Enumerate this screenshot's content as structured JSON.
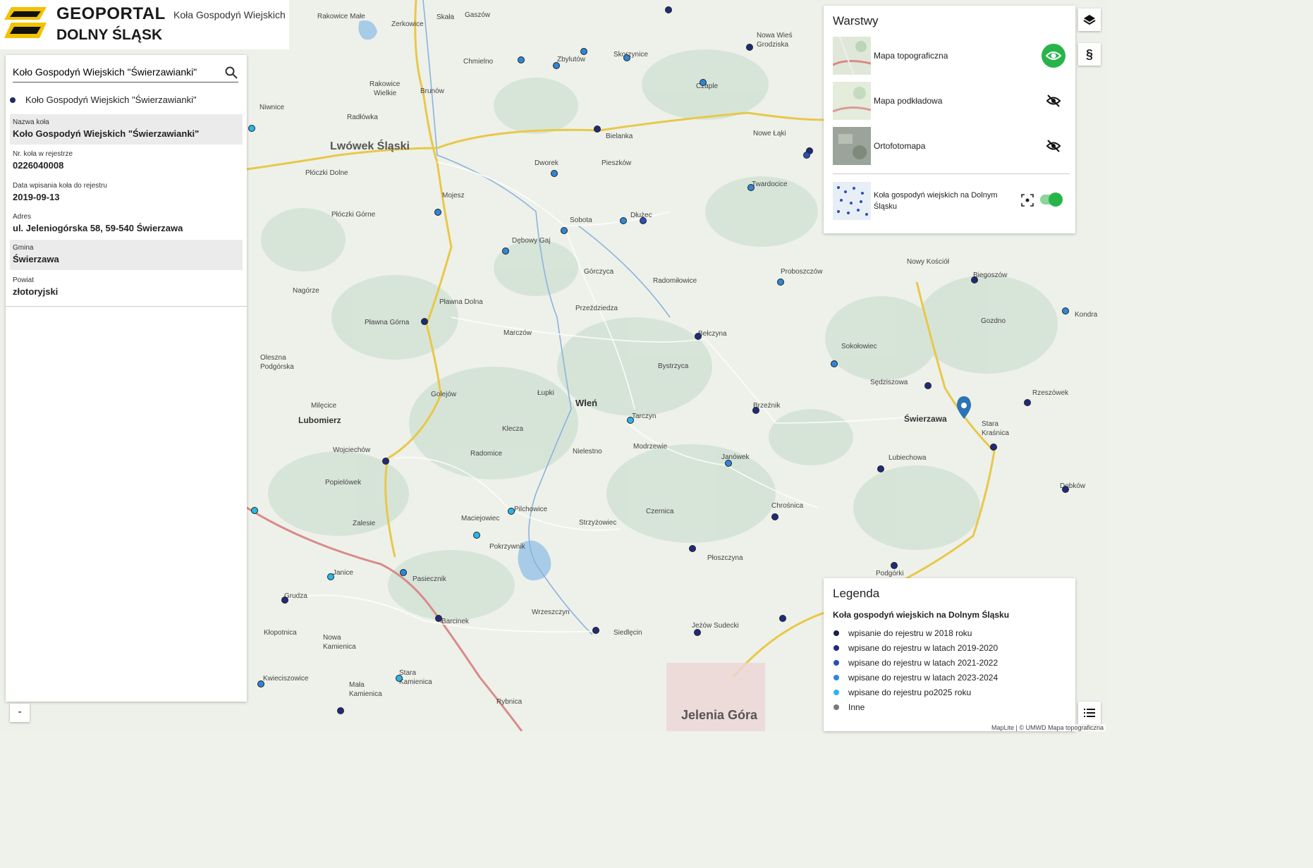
{
  "header": {
    "title_line1": "GEOPORTAL",
    "title_line2": "DOLNY ŚLĄSK",
    "subtitle": "Koła Gospodyń Wiejskich"
  },
  "search": {
    "value": "Koło Gospodyń Wiejskich \"Świerzawianki\"",
    "icon": "search-icon"
  },
  "result": {
    "label": "Koło Gospodyń Wiejskich \"Świerzawianki\""
  },
  "details": [
    {
      "label": "Nazwa koła",
      "value": "Koło Gospodyń Wiejskich \"Świerzawianki\""
    },
    {
      "label": "Nr. koła w rejestrze",
      "value": "0226040008"
    },
    {
      "label": "Data wpisania koła do rejestru",
      "value": "2019-09-13"
    },
    {
      "label": "Adres",
      "value": "ul. Jeleniogórska 58, 59-540 Świerzawa"
    },
    {
      "label": "Gmina",
      "value": "Świerzawa"
    },
    {
      "label": "Powiat",
      "value": "złotoryjski"
    }
  ],
  "collapse_label": "-",
  "layers": {
    "title": "Warstwy",
    "items": [
      {
        "name": "Mapa topograficzna",
        "visible": true
      },
      {
        "name": "Mapa podkładowa",
        "visible": false
      },
      {
        "name": "Ortofotomapa",
        "visible": false
      }
    ],
    "overlay": {
      "name": "Koła gospodyń wiejskich na Dolnym Śląsku",
      "enabled": true
    }
  },
  "right_buttons": {
    "layers": "layers-icon",
    "paragraph": "§",
    "legend": "list-icon"
  },
  "legend": {
    "title": "Legenda",
    "subtitle": "Koła gospodyń wiejskich na Dolnym Śląsku",
    "items": [
      {
        "label": "wpisanie do rejestru w 2018 roku",
        "color": "#1b1f4a"
      },
      {
        "label": "wpisane do rejestru w latach 2019-2020",
        "color": "#1f2b7a"
      },
      {
        "label": "wpisane do rejestru w latach 2021-2022",
        "color": "#2a4fb8"
      },
      {
        "label": "wpisane do rejestru w latach 2023-2024",
        "color": "#2f86d6"
      },
      {
        "label": "wpisane do rejestru po2025 roku",
        "color": "#29b6e8"
      },
      {
        "label": "Inne",
        "color": "#7a7a7a"
      }
    ]
  },
  "map_labels": [
    "Lwówek Śląski",
    "Wleń",
    "Lubomierz",
    "Świerzawa",
    "Jelenia Góra",
    "Płóczki Dolne",
    "Płóczki Górne",
    "Mojesz",
    "Dębowy Gaj",
    "Sobota",
    "Dworek",
    "Pieszków",
    "Bielanka",
    "Nowe Łąki",
    "Twardocice",
    "Dłużec",
    "Górczyca",
    "Radomiłowice",
    "Proboszczów",
    "Przeździedza",
    "Pławna Dolna",
    "Pławna Górna",
    "Marczów",
    "Bełczyna",
    "Sokołowiec",
    "Bystrzyca",
    "Golejów",
    "Łupki",
    "Klecza",
    "Tarczyn",
    "Modrzewie",
    "Brzeźnik",
    "Sędziszowa",
    "Radomice",
    "Nielestno",
    "Janówek",
    "Lubiechowa",
    "Stara Kraśnica",
    "Rzeszówek",
    "Pilchowice",
    "Maciejowiec",
    "Strzyżowiec",
    "Czernica",
    "Chrośnica",
    "Pokrzywnik",
    "Płoszczyna",
    "Podgórki",
    "Pasiecznik",
    "Barcinek",
    "Wrzeszczyn",
    "Siedlęcin",
    "Jeżów Sudecki",
    "Grudza",
    "Janice",
    "Kłopotnica",
    "Nowa Kamienica",
    "Stara Kamienica",
    "Mała Kamienica",
    "Kwieciszowice",
    "Rybnica",
    "Wojciechów",
    "Popielówek",
    "Zalesie",
    "Oleszna Podgórska",
    "Milęcice",
    "Nagórze",
    "Chmielno",
    "Zbylutów",
    "Skorzynice",
    "Rakowice Wielkie",
    "Radłówka",
    "Niwnice",
    "Brunów",
    "Skała",
    "Gaszów",
    "Zerkowice",
    "Rakowice Małe",
    "Nowa Wieś Grodziska",
    "Czaple",
    "Nowy Kościół",
    "Biegoszów",
    "Gozdno",
    "Kondratów",
    "Dobków",
    "Zbylutów"
  ],
  "attribution": "MapLite | © UMWD Mapa topograficzna"
}
